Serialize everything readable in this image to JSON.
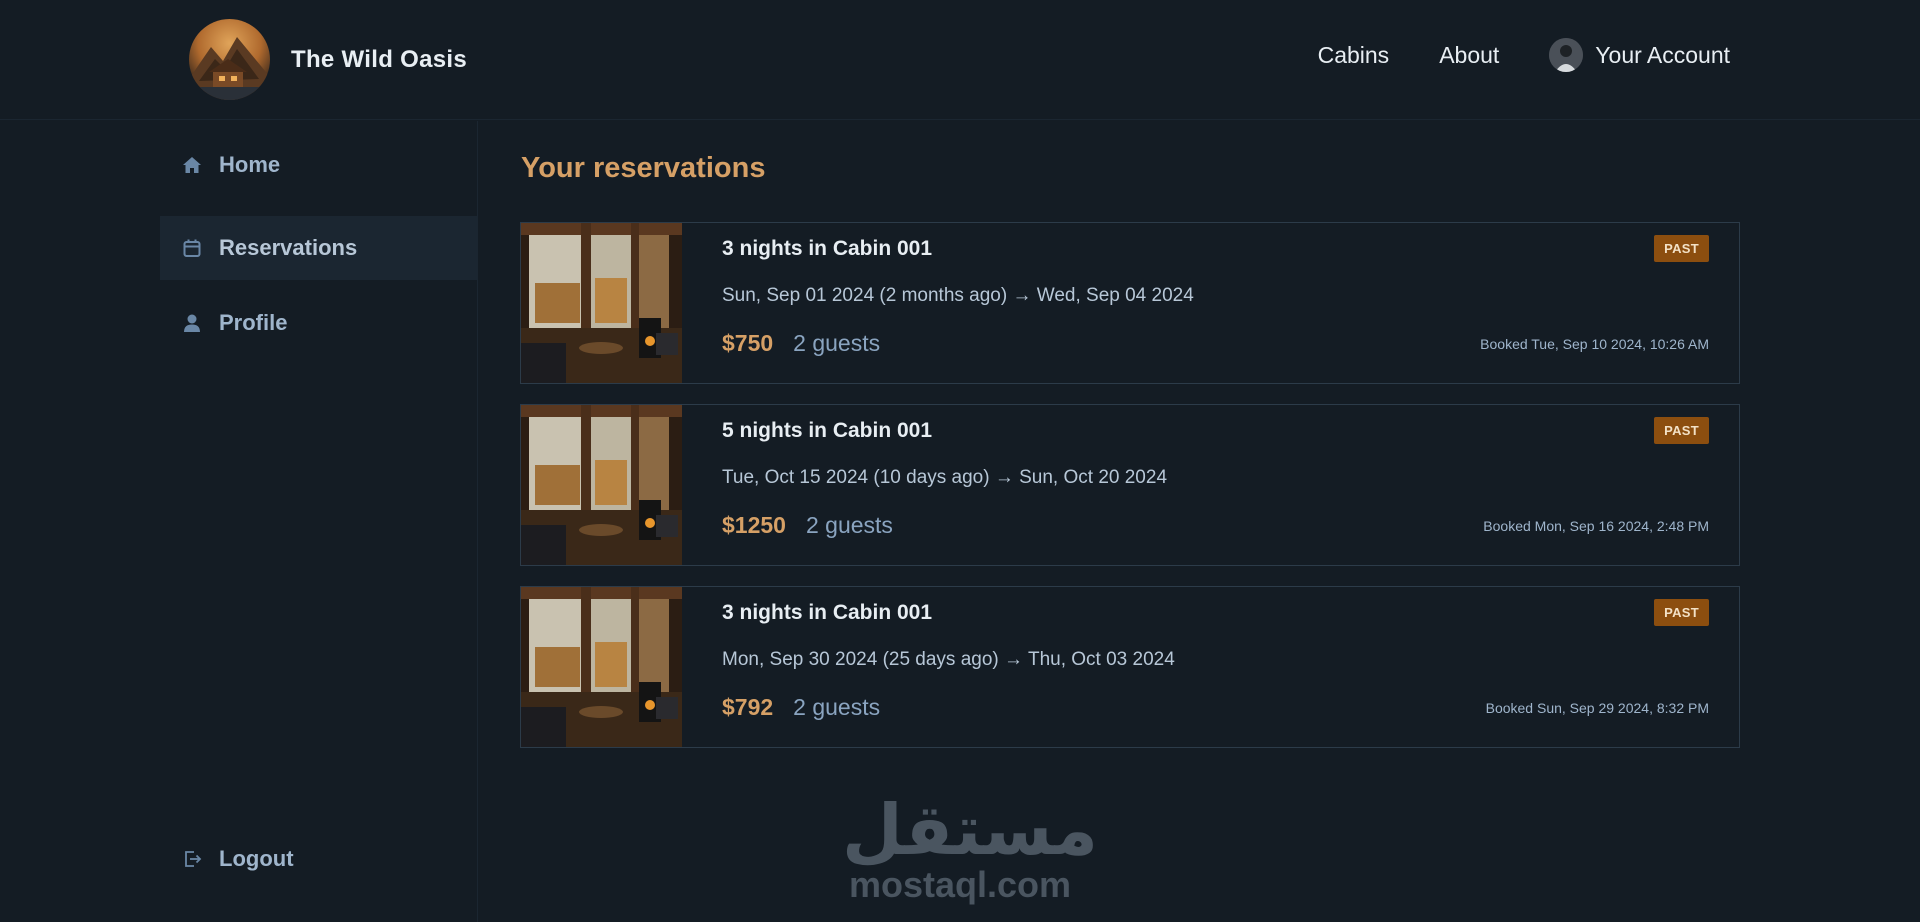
{
  "brand": {
    "name": "The Wild Oasis"
  },
  "nav": {
    "cabins": "Cabins",
    "about": "About",
    "account": "Your Account"
  },
  "sidebar": {
    "items": [
      {
        "label": "Home",
        "icon": "home-icon"
      },
      {
        "label": "Reservations",
        "icon": "calendar-icon"
      },
      {
        "label": "Profile",
        "icon": "user-icon"
      }
    ],
    "logout": {
      "label": "Logout",
      "icon": "logout-icon"
    }
  },
  "main": {
    "title": "Your reservations",
    "reservations": [
      {
        "title": "3 nights in Cabin 001",
        "dates": "Sun, Sep 01 2024 (2 months ago) → Wed, Sep 04 2024",
        "price": "$750",
        "guests": "2 guests",
        "status": "PAST",
        "booked": "Booked Tue, Sep 10 2024, 10:26 AM"
      },
      {
        "title": "5 nights in Cabin 001",
        "dates": "Tue, Oct 15 2024 (10 days ago) → Sun, Oct 20 2024",
        "price": "$1250",
        "guests": "2 guests",
        "status": "PAST",
        "booked": "Booked Mon, Sep 16 2024, 2:48 PM"
      },
      {
        "title": "3 nights in Cabin 001",
        "dates": "Mon, Sep 30 2024 (25 days ago) → Thu, Oct 03 2024",
        "price": "$792",
        "guests": "2 guests",
        "status": "PAST",
        "booked": "Booked Sun, Sep 29 2024, 8:32 PM"
      }
    ]
  },
  "watermark": {
    "arabic": "مستقل",
    "latin": "mostaql.com"
  },
  "colors": {
    "background": "#141c24",
    "accent": "#d6a066",
    "badge": "#8c4e0f",
    "sidebar_active": "#1b2631"
  }
}
